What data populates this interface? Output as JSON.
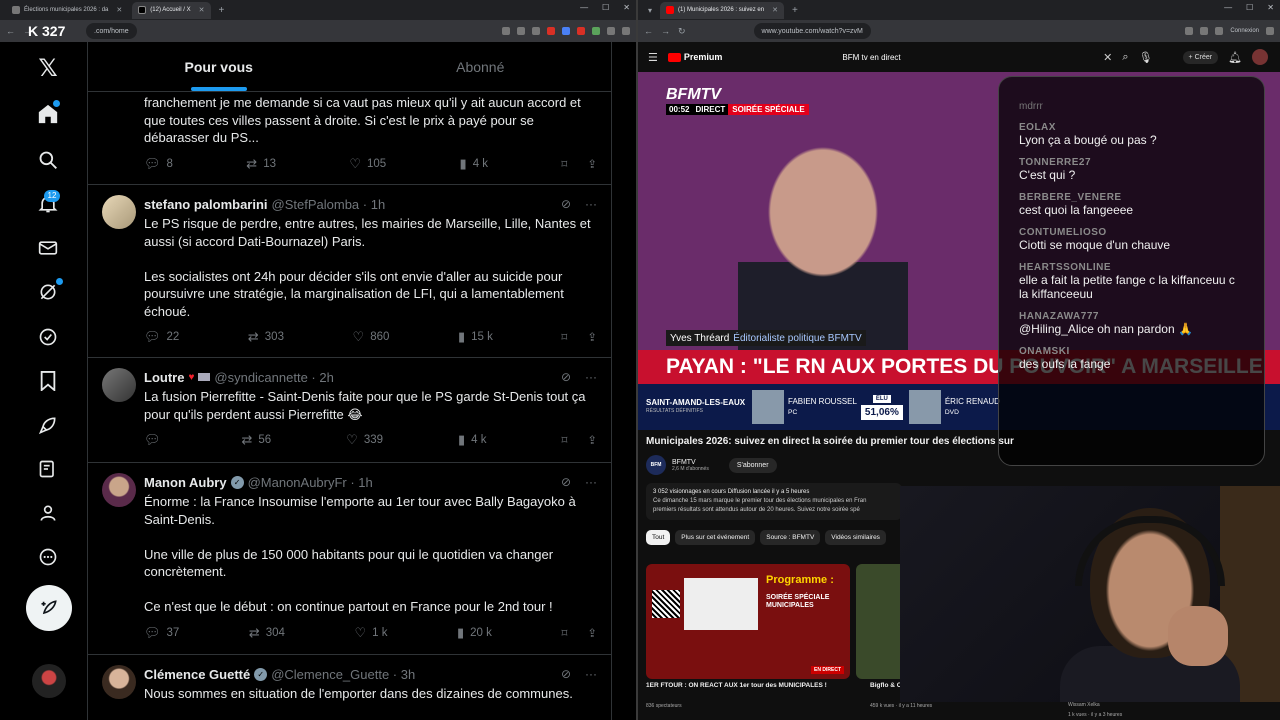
{
  "left_browser": {
    "tabs": [
      {
        "title": "Élections municipales 2026 : da",
        "active": false
      },
      {
        "title": "(12) Accueil / X",
        "active": true
      }
    ],
    "url": ".com/home",
    "overlay_logo": "K 327"
  },
  "x_app": {
    "nav": {
      "notification_count": "12"
    },
    "tabs": [
      {
        "label": "Pour vous",
        "active": true
      },
      {
        "label": "Abonné",
        "active": false
      }
    ],
    "tweets": [
      {
        "name": "",
        "handle": "",
        "time": "",
        "text": "franchement je me demande si ca vaut pas mieux qu'il y ait aucun accord et que toutes ces villes passent à droite. Si c'est le prix à payé pour se débarasser du PS...",
        "replies": "8",
        "reposts": "13",
        "likes": "105",
        "views": "4 k"
      },
      {
        "name": "stefano palombarini",
        "handle": "@StefPalomba · 1h",
        "verified": false,
        "text": "Le PS risque de perdre, entre autres, les mairies de Marseille, Lille, Nantes et aussi (si accord Dati-Bournazel) Paris.\n\nLes socialistes ont 24h pour décider s'ils ont envie d'aller au suicide pour poursuivre une stratégie, la marginalisation de LFI, qui a lamentablement échoué.",
        "replies": "22",
        "reposts": "303",
        "likes": "860",
        "views": "15 k"
      },
      {
        "name": "Loutre",
        "handle": "@syndicannette · 2h",
        "verified": false,
        "text": "La fusion Pierrefitte - Saint-Denis faite pour que le PS garde St-Denis tout ça pour qu'ils perdent aussi Pierrefitte 😂",
        "replies": "",
        "reposts": "56",
        "likes": "339",
        "views": "4 k"
      },
      {
        "name": "Manon Aubry",
        "handle": "@ManonAubryFr · 1h",
        "verified": true,
        "text": "Énorme : la France Insoumise l'emporte au 1er tour avec Bally Bagayoko à Saint-Denis.\n\nUne ville de plus de 150 000 habitants pour qui le quotidien va changer concrètement.\n\nCe n'est que le début : on continue partout en France pour le 2nd tour !",
        "replies": "37",
        "reposts": "304",
        "likes": "1 k",
        "views": "20 k"
      },
      {
        "name": "Clémence Guetté",
        "handle": "@Clemence_Guette · 3h",
        "verified": true,
        "text": "Nous sommes en situation de l'emporter dans des dizaines de communes.",
        "replies": "",
        "reposts": "",
        "likes": "",
        "views": ""
      }
    ]
  },
  "right_browser": {
    "tabs": [
      {
        "title": "(1) Municipales 2026 : suivez en",
        "active": true
      }
    ],
    "url": "www.youtube.com/watch?v=zvM",
    "profile_label": "Connexion"
  },
  "youtube": {
    "logo": "Premium",
    "search_value": "BFM tv en direct",
    "create_label": "Créer",
    "video": {
      "channel_logo": "BFMTV",
      "time": "00:52",
      "direct_label": "DIRECT",
      "show_label": "SOIRÉE SPÉCIALE",
      "guest_name": "Yves Thréard",
      "guest_role": "Éditorialiste politique BFMTV",
      "headline": "PAYAN : \"LE RN AUX PORTES DU POUVOIR\" A MARSEILLE",
      "result_city": "SAINT-AMAND-LES-EAUX",
      "result_sub": "RÉSULTATS DÉFINITIFS",
      "candidate1": "FABIEN ROUSSEL",
      "candidate1_party": "PC",
      "elu_label": "ÉLU",
      "candidate1_pct": "51,06%",
      "candidate2": "ÉRIC RENAUD",
      "candidate2_party": "DVD"
    },
    "chat": {
      "header": "mdrrr",
      "messages": [
        {
          "user": "EOLAX",
          "text": "Lyon ça a bougé ou pas ?"
        },
        {
          "user": "TONNERRE27",
          "text": "C'est qui ?"
        },
        {
          "user": "BERBERE_VENERE",
          "text": "cest quoi la fangeeee"
        },
        {
          "user": "CONTUMELIOSO",
          "text": "Ciotti se moque d'un chauve"
        },
        {
          "user": "HEARTSSONLINE",
          "text": "elle a fait la petite fange c la kiffanceuu c la kiffanceeuu"
        },
        {
          "user": "HANAZAWA777",
          "text": "@Hiling_Alice oh nan pardon 🙏"
        },
        {
          "user": "ONAMSKI",
          "text": "des oufs la fange"
        }
      ]
    },
    "title": "Municipales 2026: suivez en direct la soirée du premier tour des élections sur",
    "channel": "BFMTV",
    "subscribers": "2,6 M d'abonnés",
    "subscribe_label": "S'abonner",
    "description_line1": "3 052 visionnages en cours  Diffusion lancée il y a 5 heures",
    "description_line2": "Ce dimanche 15 mars marque le premier tour des élections municipales en Fran",
    "description_line3": "premiers résultats sont attendus autour de 20 heures. Suivez notre soirée spé",
    "chips": [
      {
        "label": "Tout",
        "active": true
      },
      {
        "label": "Plus sur cet événement",
        "active": false
      },
      {
        "label": "Source : BFMTV",
        "active": false
      },
      {
        "label": "Vidéos similaires",
        "active": false
      }
    ],
    "related": [
      {
        "title": "1ER FTOUR : ON REACT AUX 1er tour des MUNICIPALES !",
        "meta": "836 spectateurs",
        "thumb_title": "Programme :",
        "thumb_sub": "SOIRÉE SPÉCIALE MUNICIPALES",
        "badge": "EN DIRECT"
      },
      {
        "title": "Bigflo & Oli - I",
        "meta": "459 k vues · il y a 11 heures"
      },
      {
        "title": "Wissam Xelka",
        "meta": "1 k vues · il y a 3 heures"
      }
    ]
  },
  "colors": {
    "x_accent": "#1d9bf0",
    "youtube_red": "#ff0000",
    "bfm_red": "#c8102e"
  }
}
